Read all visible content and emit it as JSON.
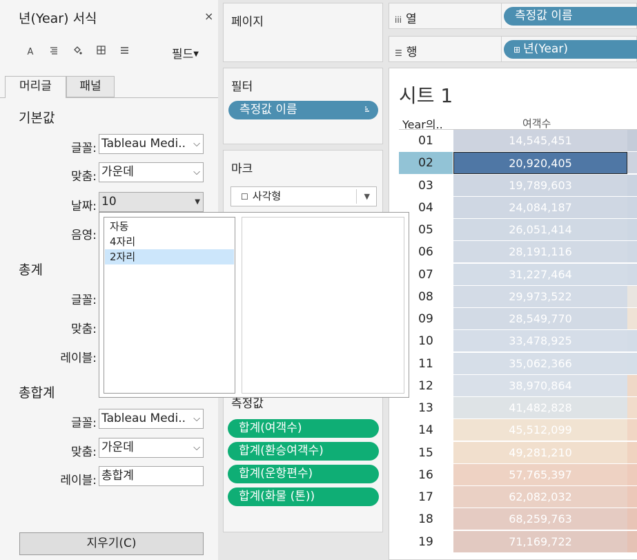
{
  "format_panel": {
    "title": "년(Year) 서식",
    "close": "×",
    "field_menu": "필드",
    "tabs": [
      "머리글",
      "패널"
    ],
    "sections": {
      "default": {
        "title": "기본값",
        "font_label": "글꼴:",
        "font_value": "Tableau Medi..",
        "align_label": "맞춤:",
        "align_value": "가운데",
        "date_label": "날짜:",
        "date_value": "10",
        "shade_label": "음영:"
      },
      "total": {
        "title": "총계",
        "font_label": "글꼴:",
        "align_label": "맞춤:",
        "label_label": "레이블:"
      },
      "grand_total": {
        "title": "총합계",
        "font_label": "글꼴:",
        "font_value": "Tableau Medi..",
        "align_label": "맞춤:",
        "align_value": "가운데",
        "label_label": "레이블:",
        "label_value": "총합계"
      }
    },
    "clear_button": "지우기(C)"
  },
  "date_popup": {
    "options": [
      "자동",
      "4자리",
      "2자리"
    ],
    "selected_index": 2
  },
  "pages_card": {
    "title": "페이지"
  },
  "filters_card": {
    "title": "필터",
    "pill": "측정값 이름"
  },
  "marks_card": {
    "title": "마크",
    "type": "사각형"
  },
  "measures_card": {
    "title": "측정값",
    "pills": [
      "합계(여객수)",
      "합계(환승여객수)",
      "합계(운항편수)",
      "합계(화물 (톤))"
    ]
  },
  "shelves": {
    "columns": {
      "label": "열",
      "pill": "측정값 이름"
    },
    "rows": {
      "label": "행",
      "pill": "년(Year)"
    }
  },
  "sheet": {
    "title": "시트 1",
    "col_headers": [
      "Year의..",
      "여객수"
    ],
    "rows": [
      {
        "year": "01",
        "value": "14,545,451",
        "color": "#cdd3df",
        "color2": "#c4ccd9"
      },
      {
        "year": "02",
        "value": "20,920,405",
        "color": "#4f77a5",
        "color2": "#cdd3df"
      },
      {
        "year": "03",
        "value": "19,789,603",
        "color": "#ced6e2",
        "color2": "#cad3e0"
      },
      {
        "year": "04",
        "value": "24,084,187",
        "color": "#cfd7e3",
        "color2": "#ccd5e2"
      },
      {
        "year": "05",
        "value": "26,051,414",
        "color": "#d0d9e4",
        "color2": "#cdd7e3"
      },
      {
        "year": "06",
        "value": "28,191,116",
        "color": "#d2dae5",
        "color2": "#cfd8e4"
      },
      {
        "year": "07",
        "value": "31,227,464",
        "color": "#d3dce7",
        "color2": "#d1dae6"
      },
      {
        "year": "08",
        "value": "29,973,522",
        "color": "#d3dbe6",
        "color2": "#e9e5e0"
      },
      {
        "year": "09",
        "value": "28,549,770",
        "color": "#d2dae5",
        "color2": "#efe3d6"
      },
      {
        "year": "10",
        "value": "33,478,925",
        "color": "#d5dde8",
        "color2": "#d3dce7"
      },
      {
        "year": "11",
        "value": "35,062,366",
        "color": "#d6dee8",
        "color2": "#d5dee8"
      },
      {
        "year": "12",
        "value": "38,970,864",
        "color": "#d9e0e9",
        "color2": "#efd8c7"
      },
      {
        "year": "13",
        "value": "41,482,828",
        "color": "#dee3e6",
        "color2": "#f1dccb"
      },
      {
        "year": "14",
        "value": "45,512,099",
        "color": "#f1e3d2",
        "color2": "#f1d6c4"
      },
      {
        "year": "15",
        "value": "49,281,210",
        "color": "#f1dfcd",
        "color2": "#f0d3c0"
      },
      {
        "year": "16",
        "value": "57,765,397",
        "color": "#eed2c3",
        "color2": "#eecbbb"
      },
      {
        "year": "17",
        "value": "62,082,032",
        "color": "#ead0c4",
        "color2": "#ecc8b9"
      },
      {
        "year": "18",
        "value": "68,259,763",
        "color": "#e5cbc2",
        "color2": "#e8c4b6"
      },
      {
        "year": "19",
        "value": "71,169,722",
        "color": "#e2c9c1",
        "color2": "#e5c2b5"
      }
    ]
  }
}
